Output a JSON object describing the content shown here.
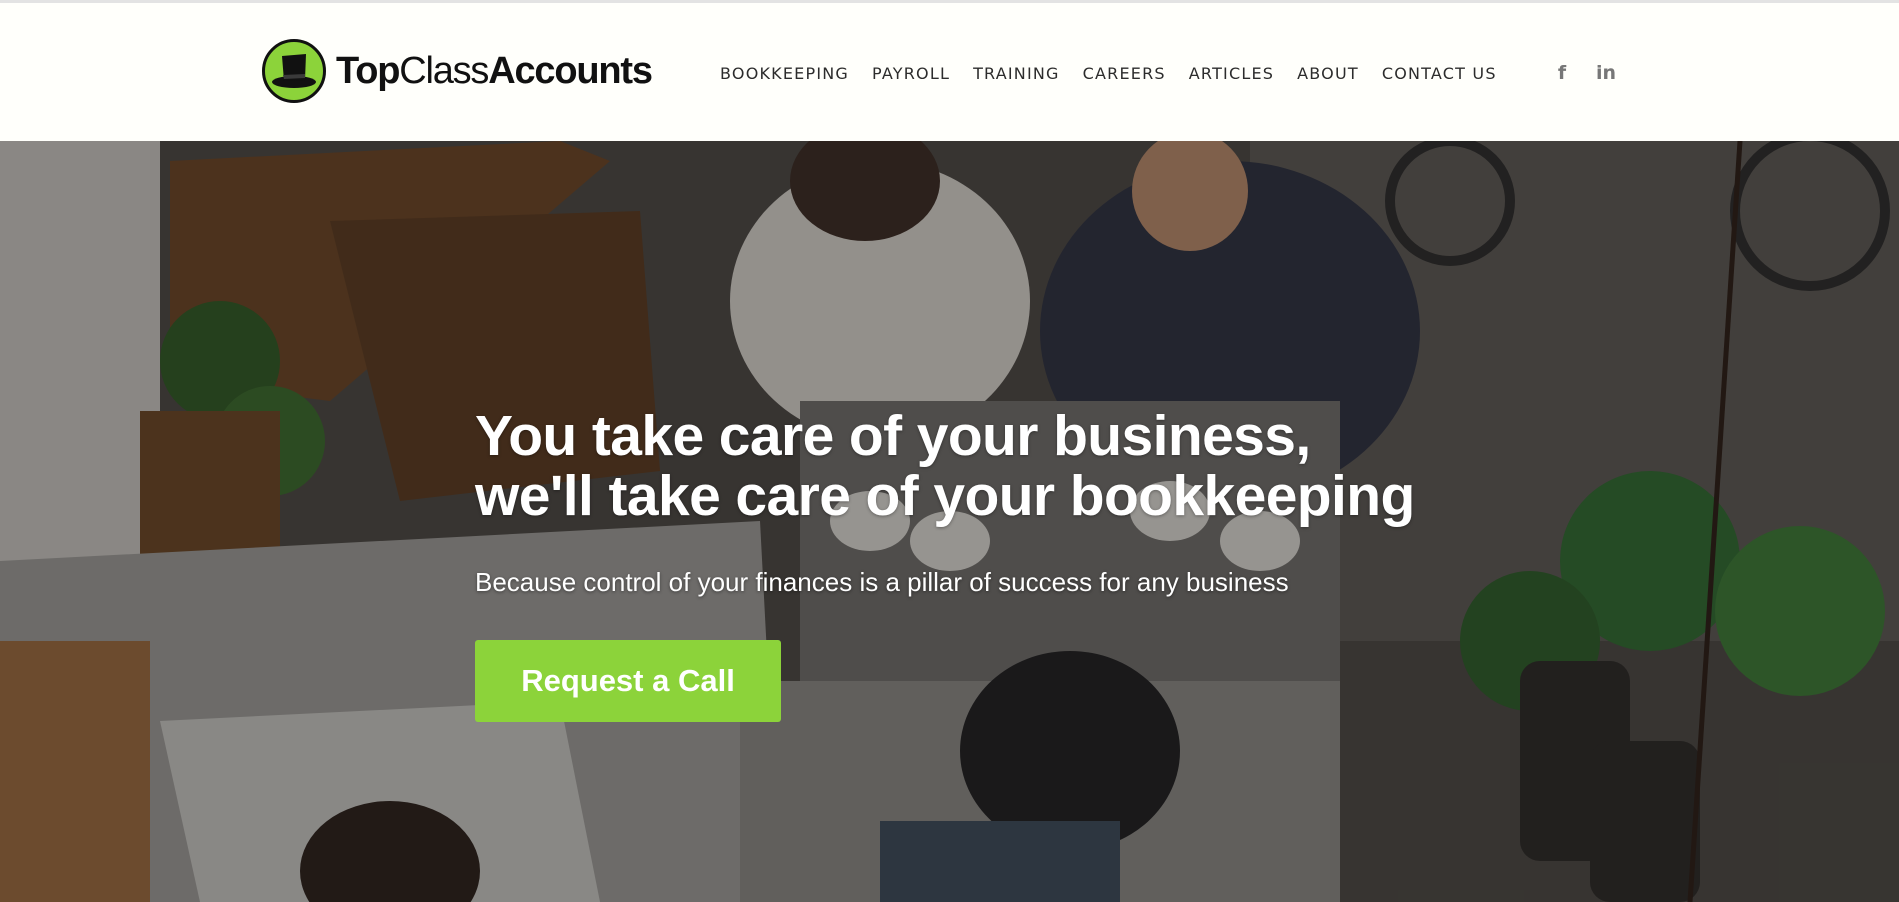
{
  "brand": {
    "name_part1": "Top",
    "name_part2": "Class",
    "name_part3": "Accounts",
    "logo_icon": "top-hat-icon",
    "accent_color": "#8cd33a"
  },
  "nav": {
    "items": [
      {
        "label": "BOOKKEEPING"
      },
      {
        "label": "PAYROLL"
      },
      {
        "label": "TRAINING"
      },
      {
        "label": "CAREERS"
      },
      {
        "label": "ARTICLES"
      },
      {
        "label": "ABOUT"
      },
      {
        "label": "CONTACT US"
      }
    ]
  },
  "social": {
    "facebook_glyph": "f",
    "linkedin_glyph": "in"
  },
  "hero": {
    "headline_line1": "You take care of your business,",
    "headline_line2": "we'll take care of your bookkeeping",
    "subheadline": "Because control of your finances is a pillar of success for any business",
    "cta_label": "Request a Call",
    "background_image": "coffee-shop-photo"
  }
}
